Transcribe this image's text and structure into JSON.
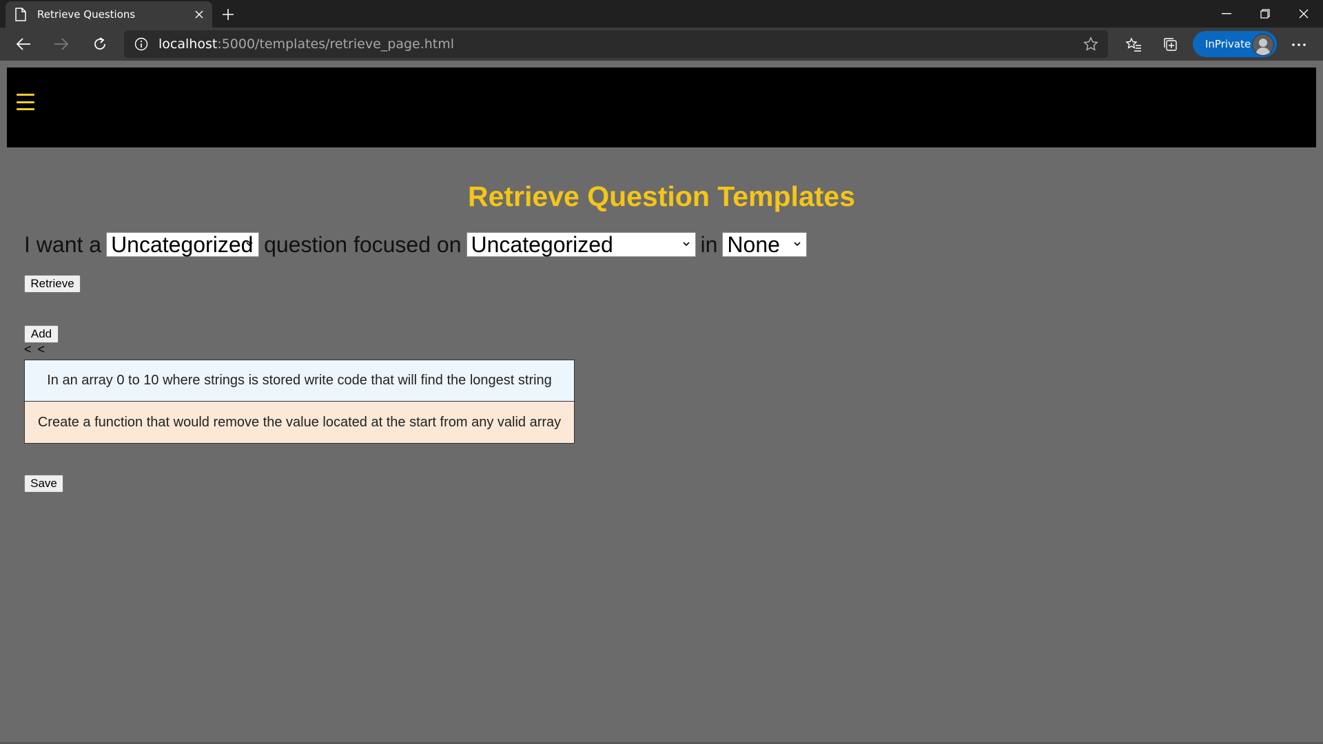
{
  "browser": {
    "tab_title": "Retrieve Questions",
    "url_host": "localhost",
    "url_rest": ":5000/templates/retrieve_page.html",
    "inprivate_label": "InPrivate",
    "icons": [
      "page-icon",
      "close-icon",
      "plus-icon",
      "back-icon",
      "forward-icon",
      "refresh-icon",
      "info-icon",
      "star-icon",
      "favorites-icon",
      "collections-icon",
      "avatar",
      "more-icon",
      "minimize-icon",
      "restore-icon",
      "close-window-icon"
    ]
  },
  "header": {
    "menu_icon": "hamburger-icon"
  },
  "main": {
    "title": "Retrieve Question Templates",
    "sentence": {
      "prefix": "I want a",
      "middle": "question focused on",
      "suffix": "in",
      "category_value": "Uncategorized",
      "topic_value": "Uncategorized",
      "language_value": "None"
    },
    "retrieve_label": "Retrieve",
    "add_label": "Add",
    "pager_text": "< <",
    "questions": [
      "In an array 0 to 10 where strings is stored write code that will find the longest string",
      "Create a function that would remove the value located at the start from any valid array"
    ],
    "save_label": "Save"
  },
  "colors": {
    "page_bg": "#6b6b6b",
    "header_bg": "#000000",
    "accent": "#f5c518",
    "question_1_bg": "#eef6fd",
    "question_2_bg": "#fbe8d6"
  }
}
